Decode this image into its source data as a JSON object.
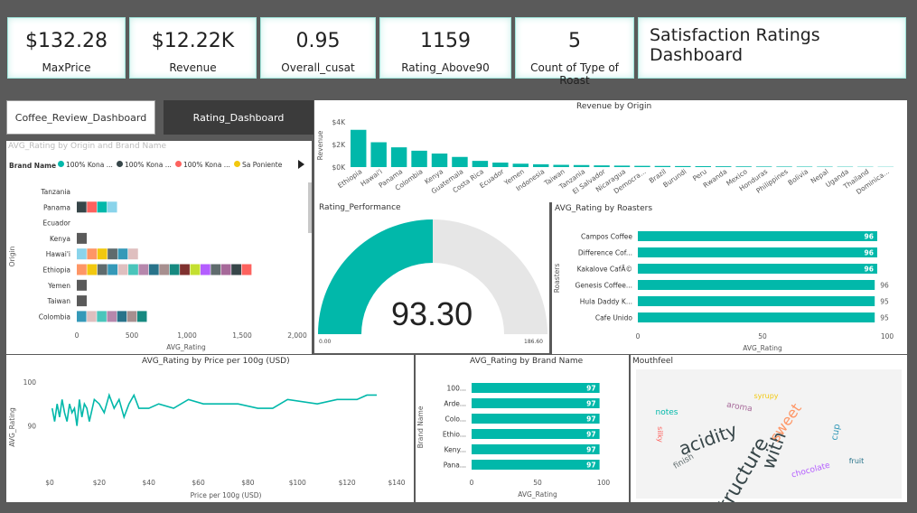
{
  "kpis": [
    {
      "value": "$132.28",
      "label": "MaxPrice"
    },
    {
      "value": "$12.22K",
      "label": "Revenue"
    },
    {
      "value": "0.95",
      "label": "Overall_cusat"
    },
    {
      "value": "1159",
      "label": "Rating_Above90"
    },
    {
      "value": "5",
      "label": "Count of Type of Roast"
    }
  ],
  "dashboard_title": "Satisfaction Ratings Dashboard",
  "tabs": [
    "Coffee_Review_Dashboard",
    "Rating_Dashboard"
  ],
  "active_tab": "Rating_Dashboard",
  "colors": {
    "accent": "#01b8aa",
    "dark": "#333333",
    "gauge_bg": "#e6e6e6"
  },
  "chart_data": [
    {
      "id": "revenue_by_origin",
      "type": "bar",
      "title": "Revenue by Origin",
      "ylabel": "Revenue",
      "yticks": [
        "$4K",
        "$2K",
        "$0K"
      ],
      "ylim": [
        0,
        4000
      ],
      "categories": [
        "Ethiopia",
        "Hawai'i",
        "Panama",
        "Colombia",
        "Kenya",
        "Guatemala",
        "Costa Rica",
        "Ecuador",
        "Yemen",
        "Indonesia",
        "Taiwan",
        "Tanzania",
        "El Salvador",
        "Nicaragua",
        "Democra...",
        "Brazil",
        "Burundi",
        "Peru",
        "Rwanda",
        "Mexico",
        "Honduras",
        "Philippines",
        "Bolivia",
        "Nepal",
        "Uganda",
        "Thailand",
        "Dominica..."
      ],
      "values": [
        3300,
        2200,
        1750,
        1450,
        1200,
        900,
        550,
        400,
        300,
        250,
        200,
        180,
        150,
        130,
        110,
        100,
        90,
        80,
        70,
        60,
        50,
        45,
        40,
        35,
        30,
        25,
        20
      ]
    },
    {
      "id": "avg_rating_origin_brand",
      "type": "bar",
      "title": "AVG_Rating by Origin and Brand Name",
      "legend_title": "Brand Name",
      "legend": [
        {
          "name": "100% Kona ...",
          "color": "#01b8aa"
        },
        {
          "name": "100% Kona ...",
          "color": "#374649"
        },
        {
          "name": "100% Kona ...",
          "color": "#fd625e"
        },
        {
          "name": "Sa Poniente",
          "color": "#f2c80f"
        }
      ],
      "ylabel": "Origin",
      "xlabel": "AVG_Rating",
      "xticks": [
        "0",
        "500",
        "1,000",
        "1,500",
        "2,000"
      ],
      "xlim": [
        0,
        2000
      ],
      "categories": [
        "Tanzania",
        "Panama",
        "Ecuador",
        "Kenya",
        "Hawai'i",
        "Ethiopia",
        "Yemen",
        "Taiwan",
        "Colombia"
      ],
      "values": [
        0,
        370,
        0,
        95,
        560,
        1590,
        95,
        95,
        640
      ],
      "segments": [
        0,
        4,
        0,
        1,
        6,
        17,
        1,
        1,
        7
      ]
    },
    {
      "id": "rating_performance",
      "type": "gauge",
      "title": "Rating_Performance",
      "value": 93.3,
      "value_label": "93.30",
      "min_label": "0.00",
      "max_label": "186.60",
      "max": 186.6
    },
    {
      "id": "avg_rating_roasters",
      "type": "bar",
      "title": "AVG_Rating by Roasters",
      "ylabel": "Roasters",
      "xlabel": "AVG_Rating",
      "xticks": [
        "0",
        "50",
        "100"
      ],
      "xlim": [
        0,
        100
      ],
      "categories": [
        "Campos Coffee",
        "Difference Cof...",
        "Kakalove CafÃ©",
        "Genesis Coffee...",
        "Hula Daddy K...",
        "Cafe Unido"
      ],
      "values": [
        96,
        96,
        96,
        95,
        95,
        95
      ],
      "labels": [
        "96",
        "96",
        "96",
        "96",
        "95",
        "95"
      ]
    },
    {
      "id": "avg_rating_price",
      "type": "line",
      "title": "AVG_Rating by Price per 100g (USD)",
      "ylabel": "AVG_Rating",
      "xlabel": "Price per 100g (USD)",
      "yticks": [
        "100",
        "90"
      ],
      "ylim": [
        86,
        101
      ],
      "xticks": [
        "$0",
        "$20",
        "$40",
        "$60",
        "$80",
        "$100",
        "$120",
        "$140"
      ],
      "xlim": [
        0,
        140
      ],
      "x": [
        1,
        2,
        3,
        4,
        5,
        6,
        7,
        8,
        9,
        10,
        11,
        12,
        13,
        14,
        15,
        16,
        18,
        20,
        22,
        24,
        26,
        28,
        30,
        32,
        34,
        36,
        40,
        44,
        50,
        56,
        62,
        70,
        76,
        84,
        90,
        96,
        108,
        116,
        120,
        124,
        128,
        132
      ],
      "y": [
        94,
        91,
        95,
        92,
        96,
        93,
        91,
        95,
        93,
        94,
        90,
        96,
        92,
        95,
        94,
        91,
        96,
        95,
        93,
        97,
        94,
        96,
        92,
        95,
        97,
        94,
        94,
        95,
        94,
        96,
        95,
        95,
        95,
        94,
        94,
        96,
        95,
        96,
        96,
        96,
        97,
        97
      ]
    },
    {
      "id": "avg_rating_brand",
      "type": "bar",
      "title": "AVG_Rating by Brand Name",
      "ylabel": "Brand Name",
      "xlabel": "AVG_Rating",
      "xticks": [
        "0",
        "50",
        "100"
      ],
      "xlim": [
        0,
        100
      ],
      "categories": [
        "100...",
        "Arde...",
        "Colo...",
        "Ethio...",
        "Keny...",
        "Pana..."
      ],
      "values": [
        97,
        97,
        97,
        97,
        97,
        97
      ],
      "labels": [
        "97",
        "97",
        "97",
        "97",
        "97",
        "97"
      ]
    }
  ],
  "mouthfeel": {
    "title": "Mouthfeel",
    "words": [
      "acidity",
      "structure",
      "with",
      "sweet",
      "notes",
      "aroma",
      "cup",
      "finish",
      "chocolate",
      "silky",
      "fruit",
      "syrupy"
    ]
  }
}
